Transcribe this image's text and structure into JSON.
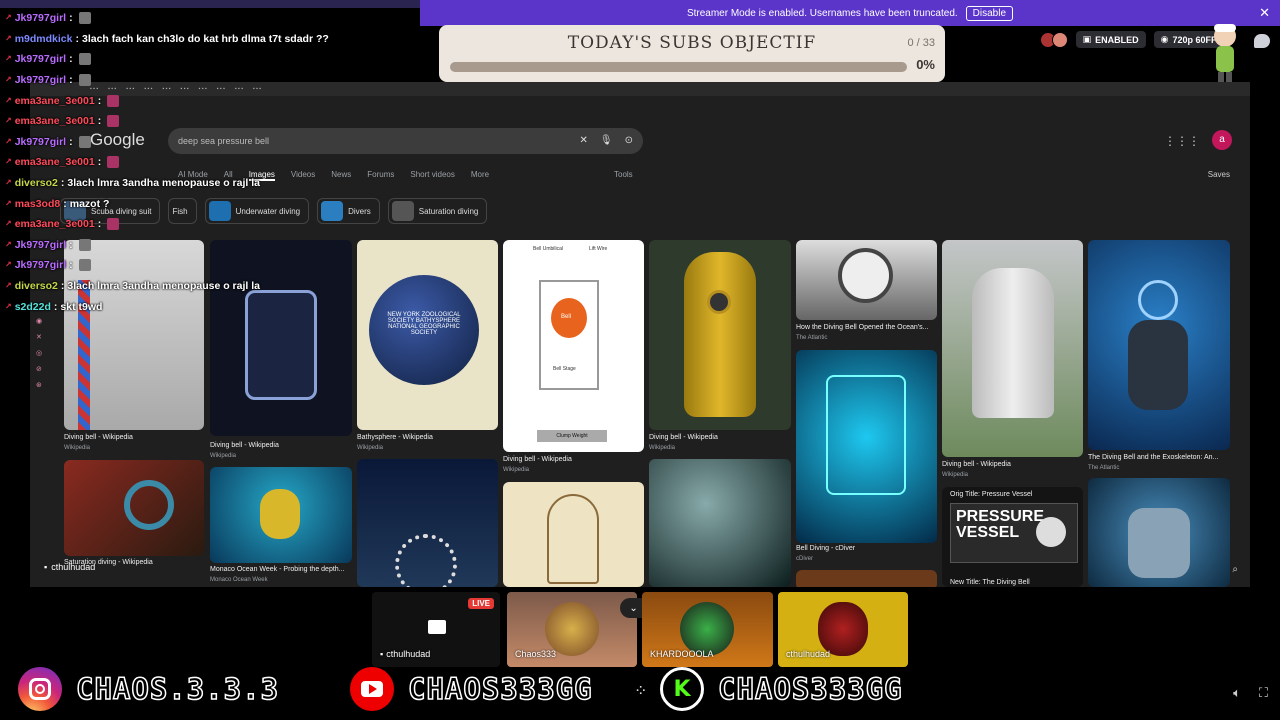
{
  "banner": {
    "text": "Streamer Mode is enabled. Usernames have been truncated.",
    "button": "Disable",
    "close": "✕"
  },
  "subs_goal": {
    "title": "TODAY'S SUBS OBJECTIF",
    "count": "0 / 33",
    "percent": "0%",
    "progress": 0
  },
  "stream_controls": {
    "enabled_label": "ENABLED",
    "quality_label": "720p 60FPS"
  },
  "chat": [
    {
      "user": "Jk9797girl",
      "color": "purple",
      "text": "",
      "badge": true
    },
    {
      "user": "m9dmdkick",
      "color": "blue",
      "text": "3lach fach kan ch3lo do kat hrb dlma t7t sdadr ??"
    },
    {
      "user": "Jk9797girl",
      "color": "purple",
      "text": "",
      "badge": true
    },
    {
      "user": "Jk9797girl",
      "color": "purple",
      "text": "",
      "badge": true
    },
    {
      "user": "ema3ane_3e001",
      "color": "red",
      "text": "",
      "badge": true
    },
    {
      "user": "ema3ane_3e001",
      "color": "red",
      "text": "",
      "badge": true
    },
    {
      "user": "Jk9797girl",
      "color": "purple",
      "text": "",
      "badge": true
    },
    {
      "user": "ema3ane_3e001",
      "color": "red",
      "text": "",
      "badge": true
    },
    {
      "user": "diverso2",
      "color": "lime",
      "text": "3lach lmra 3andha menopause o rajl la"
    },
    {
      "user": "mas3od8",
      "color": "red",
      "text": "mazot ?"
    },
    {
      "user": "ema3ane_3e001",
      "color": "red",
      "text": "",
      "badge": true
    },
    {
      "user": "Jk9797girl",
      "color": "purple",
      "text": "",
      "badge": true
    },
    {
      "user": "Jk9797girl",
      "color": "purple",
      "text": "",
      "badge": true
    },
    {
      "user": "diverso2",
      "color": "lime",
      "text": "3lach lmra 3andha menopause o rajl la"
    },
    {
      "user": "s2d22d",
      "color": "cyan",
      "text": "skt t9wd"
    }
  ],
  "browser": {
    "logo": "Google",
    "search_query": "deep sea pressure bell",
    "tabs": [
      "AI Mode",
      "All",
      "Images",
      "Videos",
      "News",
      "Forums",
      "Short videos",
      "More"
    ],
    "tools": "Tools",
    "saves": "Saves",
    "avatar_letter": "a",
    "chips": [
      "Scuba diving suit",
      "Fish",
      "Underwater diving",
      "Divers",
      "Saturation diving"
    ],
    "results": [
      {
        "caption": "Diving bell - Wikipedia",
        "source": "Wikipedia"
      },
      {
        "caption": "Diving bell - Wikipedia",
        "source": "Wikipedia"
      },
      {
        "caption": "Bathysphere - Wikipedia",
        "source": "Wikipedia"
      },
      {
        "caption": "Diving bell - Wikipedia",
        "source": "Wikipedia"
      },
      {
        "caption": "Diving bell - Wikipedia",
        "source": "Wikipedia"
      },
      {
        "caption": "How the Diving Bell Opened the Ocean's...",
        "source": "The Atlantic"
      },
      {
        "caption": "Diving bell - Wikipedia",
        "source": "Wikipedia"
      },
      {
        "caption": "The Diving Bell and the Exoskeleton: An...",
        "source": "The Atlantic"
      },
      {
        "caption": "Saturation diving - Wikipedia",
        "source": ""
      },
      {
        "caption": "Monaco Ocean Week - Probing the depth...",
        "source": "Monaco Ocean Week"
      },
      {
        "caption": "Bell Diving - cDiver",
        "source": "cDiver"
      },
      {
        "caption": "Orig Title: Pressure Vessel",
        "source": ""
      },
      {
        "caption": "New Title: The Diving Bell",
        "source": ""
      }
    ],
    "pressure_vessel_text": "PRESSURE VESSEL",
    "diagram_labels": {
      "umbilical": "Bell Umbilical",
      "lift": "Lift Wire",
      "bell": "Bell",
      "stage": "Bell Stage",
      "clump": "Clump Weight"
    },
    "bathysphere_text": "NEW YORK ZOOLOGICAL SOCIETY BATHYSPHERE NATIONAL GEOGRAPHIC SOCIETY"
  },
  "webcams": {
    "live": "LIVE",
    "screen_user": "cthulhudad",
    "overlay_user": "cthulhudad",
    "cams": [
      {
        "name": "Chaos333"
      },
      {
        "name": "KHARDOOOLA"
      },
      {
        "name": "cthulhudad"
      }
    ]
  },
  "socials": {
    "instagram": "CHAOS.3.3.3",
    "youtube": "CHAOS333GG",
    "kick": "CHAOS333GG"
  },
  "colors": {
    "banner": "#5b34c9",
    "chat_purple": "#b96cff",
    "chat_red": "#ff4a5a",
    "chat_lime": "#c6d84a",
    "chat_cyan": "#55e2d8",
    "kick_green": "#53fc18",
    "youtube_red": "#ff0000"
  }
}
